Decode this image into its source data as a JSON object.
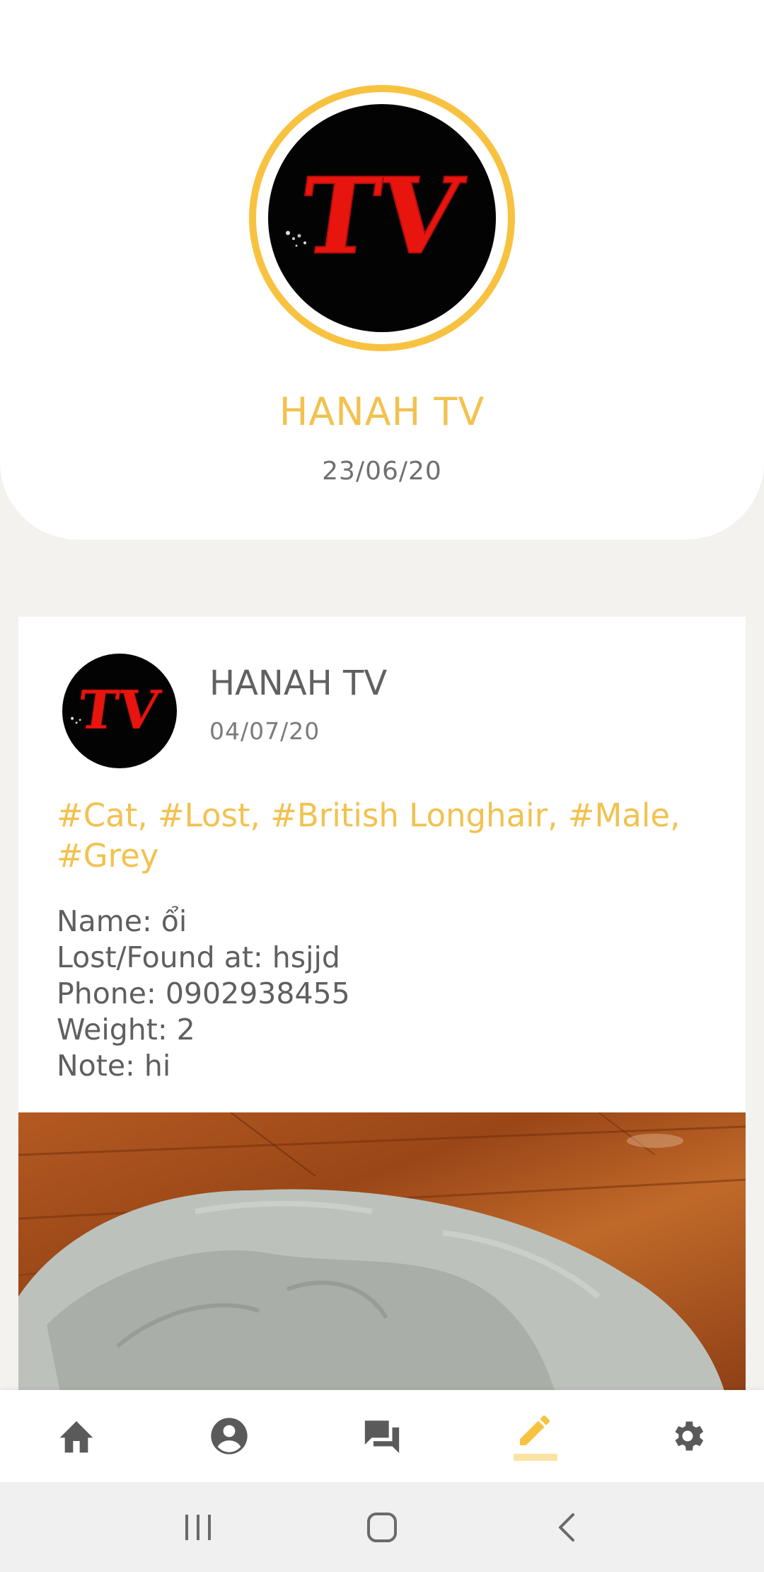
{
  "profile": {
    "name": "HANAH TV",
    "date": "23/06/20",
    "avatar_text": "TV"
  },
  "post": {
    "author": "HANAH TV",
    "date": "04/07/20",
    "avatar_text": "TV",
    "tags": "#Cat, #Lost, #British Longhair, #Male, #Grey",
    "details": [
      "Name: ổi",
      "Lost/Found at: hsjjd",
      "Phone: 0902938455",
      "Weight: 2",
      "Note: hi"
    ]
  },
  "bottom_nav": {
    "items": [
      {
        "icon": "home-icon",
        "active": false
      },
      {
        "icon": "account-circle-icon",
        "active": false
      },
      {
        "icon": "chat-icon",
        "active": false
      },
      {
        "icon": "edit-pencil-icon",
        "active": true
      },
      {
        "icon": "settings-gear-icon",
        "active": false
      }
    ]
  },
  "system_nav": {
    "items": [
      {
        "icon": "recent-apps-icon"
      },
      {
        "icon": "home-square-icon"
      },
      {
        "icon": "back-chevron-icon"
      }
    ]
  },
  "colors": {
    "accent": "#f8c241",
    "accent_text": "#f2c24f",
    "icon_gray": "#5a5a5a",
    "background": "#f3f2ef",
    "logo_red": "#e8150f"
  }
}
